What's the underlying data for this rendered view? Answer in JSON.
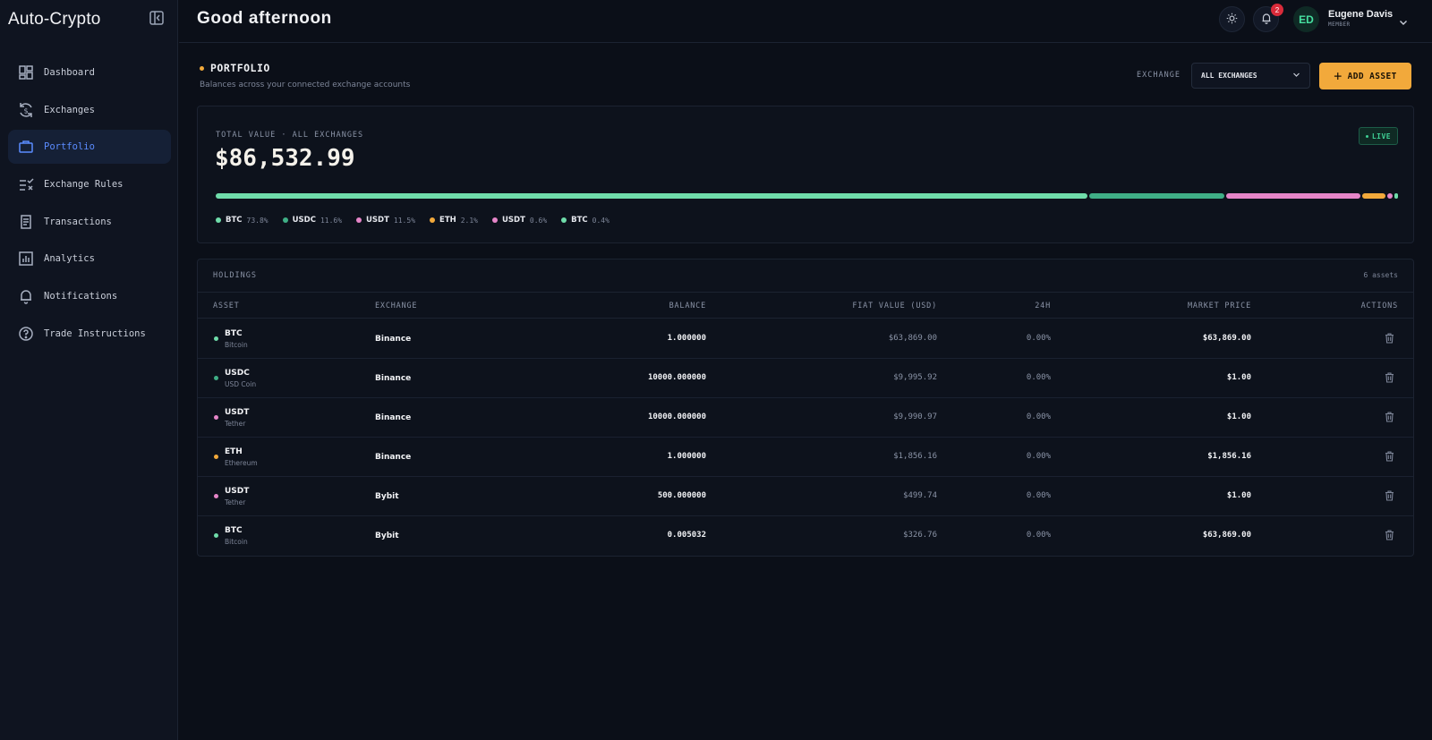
{
  "app": {
    "brand": "Auto-Crypto"
  },
  "sidebar": {
    "items": [
      {
        "label": "Dashboard",
        "icon": "dashboard-icon"
      },
      {
        "label": "Exchanges",
        "icon": "exchange-icon"
      },
      {
        "label": "Portfolio",
        "icon": "briefcase-icon",
        "active": true
      },
      {
        "label": "Exchange Rules",
        "icon": "rules-icon"
      },
      {
        "label": "Transactions",
        "icon": "receipt-icon"
      },
      {
        "label": "Analytics",
        "icon": "chart-icon"
      },
      {
        "label": "Notifications",
        "icon": "bell-icon"
      },
      {
        "label": "Trade Instructions",
        "icon": "help-icon"
      }
    ]
  },
  "header": {
    "greeting": "Good afternoon",
    "notification_count": "2",
    "user": {
      "initials": "ED",
      "name": "Eugene Davis",
      "role": "MEMBER"
    }
  },
  "page": {
    "title": "PORTFOLIO",
    "subtitle": "Balances across your connected exchange accounts",
    "exchange_label": "EXCHANGE",
    "exchange_selected": "ALL EXCHANGES",
    "add_button": "ADD ASSET"
  },
  "summary": {
    "label": "TOTAL VALUE · ALL EXCHANGES",
    "value": "$86,532.99",
    "live": "LIVE",
    "allocation": [
      {
        "asset": "BTC",
        "pct_label": "73.8%",
        "pct": 73.8,
        "color": "#6fdcaa"
      },
      {
        "asset": "USDC",
        "pct_label": "11.6%",
        "pct": 11.6,
        "color": "#3fae86"
      },
      {
        "asset": "USDT",
        "pct_label": "11.5%",
        "pct": 11.5,
        "color": "#e585c8"
      },
      {
        "asset": "ETH",
        "pct_label": "2.1%",
        "pct": 2.1,
        "color": "#f2a93b"
      },
      {
        "asset": "USDT",
        "pct_label": "0.6%",
        "pct": 0.6,
        "color": "#e585c8"
      },
      {
        "asset": "BTC",
        "pct_label": "0.4%",
        "pct": 0.4,
        "color": "#6fdcaa"
      }
    ]
  },
  "holdings": {
    "title": "HOLDINGS",
    "count": "6 assets",
    "columns": {
      "asset": "ASSET",
      "exchange": "EXCHANGE",
      "balance": "BALANCE",
      "fiat": "FIAT VALUE (USD)",
      "change": "24H",
      "price": "MARKET PRICE",
      "actions": "ACTIONS"
    },
    "rows": [
      {
        "symbol": "BTC",
        "name": "Bitcoin",
        "exchange": "Binance",
        "balance": "1.000000",
        "fiat": "$63,869.00",
        "change": "0.00%",
        "price": "$63,869.00",
        "color": "#6fdcaa"
      },
      {
        "symbol": "USDC",
        "name": "USD Coin",
        "exchange": "Binance",
        "balance": "10000.000000",
        "fiat": "$9,995.92",
        "change": "0.00%",
        "price": "$1.00",
        "color": "#3fae86"
      },
      {
        "symbol": "USDT",
        "name": "Tether",
        "exchange": "Binance",
        "balance": "10000.000000",
        "fiat": "$9,990.97",
        "change": "0.00%",
        "price": "$1.00",
        "color": "#e585c8"
      },
      {
        "symbol": "ETH",
        "name": "Ethereum",
        "exchange": "Binance",
        "balance": "1.000000",
        "fiat": "$1,856.16",
        "change": "0.00%",
        "price": "$1,856.16",
        "color": "#f2a93b"
      },
      {
        "symbol": "USDT",
        "name": "Tether",
        "exchange": "Bybit",
        "balance": "500.000000",
        "fiat": "$499.74",
        "change": "0.00%",
        "price": "$1.00",
        "color": "#e585c8"
      },
      {
        "symbol": "BTC",
        "name": "Bitcoin",
        "exchange": "Bybit",
        "balance": "0.005032",
        "fiat": "$326.76",
        "change": "0.00%",
        "price": "$63,869.00",
        "color": "#6fdcaa"
      }
    ]
  }
}
